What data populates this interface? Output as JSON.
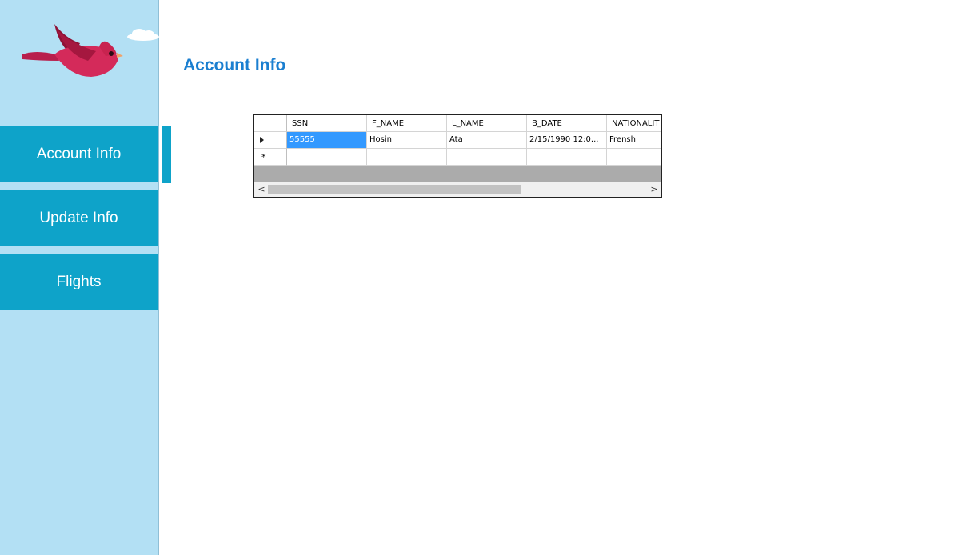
{
  "sidebar": {
    "logo": "cardinal-bird-logo",
    "items": [
      {
        "label": "Account Info"
      },
      {
        "label": "Update Info"
      },
      {
        "label": "Flights"
      }
    ]
  },
  "main": {
    "title": "Account Info"
  },
  "grid": {
    "columns": [
      "SSN",
      "F_NAME",
      "L_NAME",
      "B_DATE",
      "NATIONALIT"
    ],
    "rows": [
      [
        "55555",
        "Hosin",
        "Ata",
        "2/15/1990 12:0...",
        "Frensh"
      ]
    ],
    "new_row_marker": "*",
    "current_row_marker": "▶",
    "scroll_left_arrow": "<",
    "scroll_right_arrow": ">"
  },
  "colors": {
    "sidebar_bg": "#b3e0f4",
    "nav_bg": "#0ea3c9",
    "title": "#1b7fd0",
    "selection": "#3399ff"
  }
}
